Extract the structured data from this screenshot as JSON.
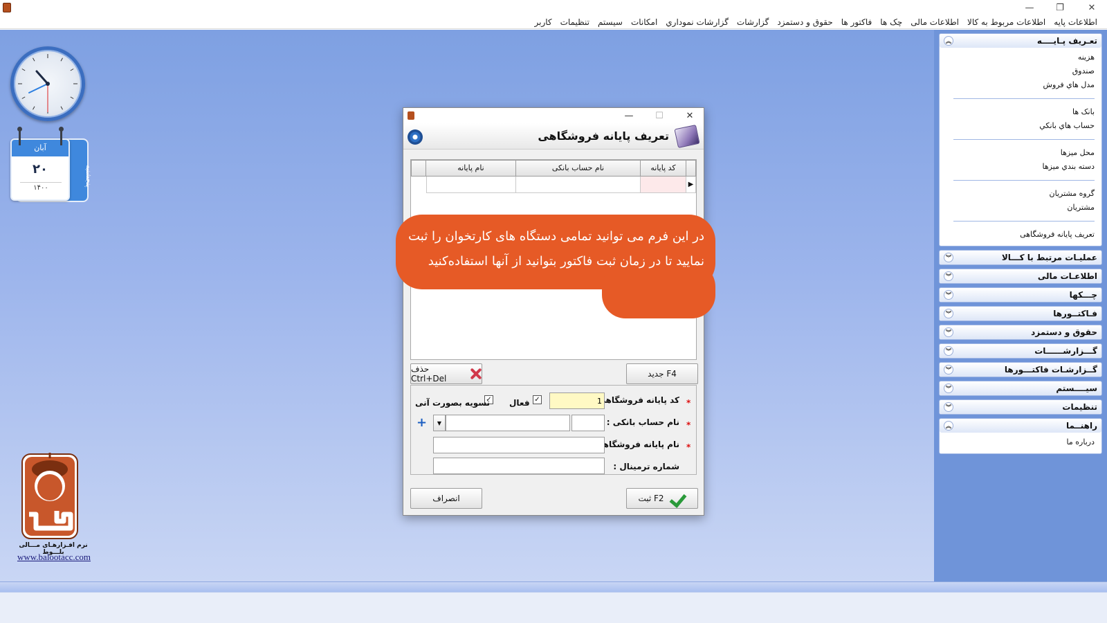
{
  "window": {
    "minimize": "—",
    "restore": "❐",
    "close": "✕"
  },
  "menu": [
    "اطلاعات پایه",
    "اطلاعات مربوط به کالا",
    "اطلاعات مالی",
    "چک ها",
    "فاکتور ها",
    "حقوق و دستمزد",
    "گزارشات",
    "گزارشات نموداري",
    "امکانات",
    "سیستم",
    "تنظیمات",
    "کاربر"
  ],
  "calendar": {
    "month": "آبان",
    "day": "۲۰",
    "year": "۱۴۰۰",
    "weekday": "پنجشنبه"
  },
  "logo": {
    "caption": "نرم افـزارهـای مـــالی بلـــوط",
    "url": "www.balootacc.com"
  },
  "sidebar": {
    "sections": [
      {
        "title": "تعـریف پـایــــه",
        "expanded": true,
        "groups": [
          [
            "هزینه",
            "صندوق",
            "مدل هاي فروش"
          ],
          [
            "بانک ها",
            "حساب هاي بانکي"
          ],
          [
            "محل میزها",
            "دسته بندي میزها"
          ],
          [
            "گروه مشتریان",
            "مشتریان"
          ],
          [
            "تعریف پایانه فروشگاهی"
          ]
        ]
      },
      {
        "title": "عملیـات مرتبط با کـــالا",
        "expanded": false
      },
      {
        "title": "اطلاعـات مالی",
        "expanded": false
      },
      {
        "title": "چـــکها",
        "expanded": false
      },
      {
        "title": "فـاکتــورها",
        "expanded": false
      },
      {
        "title": "حقوق و دستمزد",
        "expanded": false
      },
      {
        "title": "گـــزارشــــــات",
        "expanded": false
      },
      {
        "title": "گــزارشـات فاکتـــورها",
        "expanded": false
      },
      {
        "title": "سیــــستم",
        "expanded": false
      },
      {
        "title": "تنظیمات",
        "expanded": false
      },
      {
        "title": "راهنــما",
        "expanded": true,
        "groups": [
          [
            "درباره ما"
          ]
        ]
      }
    ]
  },
  "dialog": {
    "title": "تعریف پایانه فروشگاهی",
    "grid": {
      "columns": [
        "کد پایانه",
        "نام حساب بانکی",
        "نام پایانه"
      ]
    },
    "bubble_text": "در این فرم می توانید تمامی دستگاه های کارتخوان را ثبت نمایید تا در زمان ثبت فاکتور بتوانید از آنها استفاده‌کنید",
    "buttons": {
      "new": "جدید    F4",
      "delete": "حذف Ctrl+Del",
      "save": "ثبت    F2",
      "cancel": "انصراف"
    },
    "form": {
      "terminal_code_label": "کد پایانه فروشگاهی :",
      "terminal_code_value": "1",
      "active_label": "فعال",
      "settle_label": "تسویه بصورت آنی",
      "bank_account_label": "نام حساب بانکی :",
      "terminal_name_label": "نام پایانه فروشگاهی :",
      "terminal_number_label": "شماره ترمینال :"
    }
  },
  "colors": {
    "desktop_top": "#7ea0e2",
    "panel": "#6f94d9",
    "bubble": "#e65a26",
    "required": "#dd1111"
  }
}
